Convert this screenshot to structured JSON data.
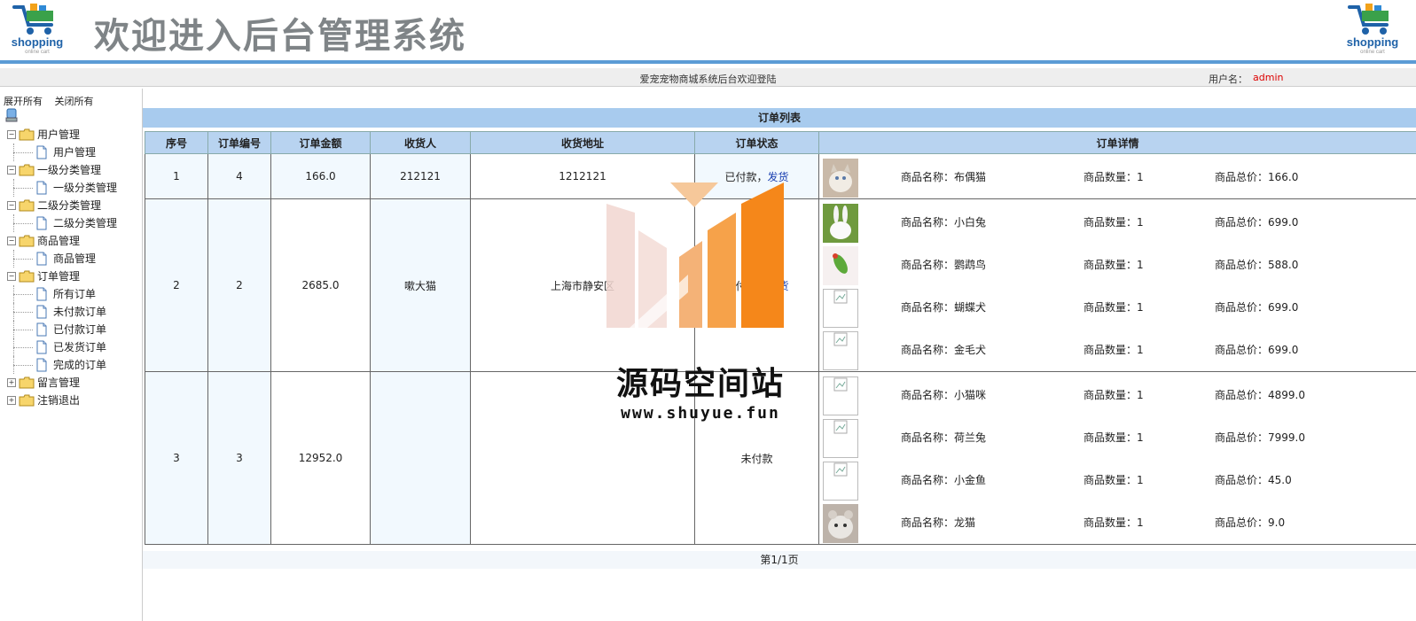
{
  "header": {
    "title": "欢迎进入后台管理系统",
    "logo_word": "shopping",
    "logo_sub": "online cart"
  },
  "welcome_bar": {
    "message": "爱宠宠物商城系统后台欢迎登陆",
    "user_label": "用户名：",
    "user_name": "admin"
  },
  "sidebar": {
    "expand_all": "展开所有",
    "collapse_all": "关闭所有",
    "groups": [
      {
        "label": "用户管理",
        "children": [
          "用户管理"
        ]
      },
      {
        "label": "一级分类管理",
        "children": [
          "一级分类管理"
        ]
      },
      {
        "label": "二级分类管理",
        "children": [
          "二级分类管理"
        ]
      },
      {
        "label": "商品管理",
        "children": [
          "商品管理"
        ]
      },
      {
        "label": "订单管理",
        "children": [
          "所有订单",
          "未付款订单",
          "已付款订单",
          "已发货订单",
          "完成的订单"
        ]
      },
      {
        "label": "留言管理",
        "children": []
      },
      {
        "label": "注销退出",
        "children": []
      }
    ]
  },
  "orders": {
    "caption": "订单列表",
    "headers": [
      "序号",
      "订单编号",
      "订单金额",
      "收货人",
      "收货地址",
      "订单状态",
      "订单详情"
    ],
    "detail_labels": {
      "name": "商品名称：",
      "qty": "商品数量：",
      "total": "商品总价："
    },
    "rows": [
      {
        "index": "1",
        "order_no": "4",
        "amount": "166.0",
        "receiver": "212121",
        "address": "1212121",
        "status": "已付款，",
        "action": "发货",
        "items": [
          {
            "name": "布偶猫",
            "qty": "1",
            "total": "166.0",
            "thumb": "photo-cat"
          }
        ]
      },
      {
        "index": "2",
        "order_no": "2",
        "amount": "2685.0",
        "receiver": "嗽大猫",
        "address": "上海市静安区",
        "status": "已付款，",
        "action": "发货",
        "items": [
          {
            "name": "小白兔",
            "qty": "1",
            "total": "699.0",
            "thumb": "photo-rabbit"
          },
          {
            "name": "鹦鹉鸟",
            "qty": "1",
            "total": "588.0",
            "thumb": "photo-parrot"
          },
          {
            "name": "蝴蝶犬",
            "qty": "1",
            "total": "699.0",
            "thumb": "broken"
          },
          {
            "name": "金毛犬",
            "qty": "1",
            "total": "699.0",
            "thumb": "broken"
          }
        ]
      },
      {
        "index": "3",
        "order_no": "3",
        "amount": "12952.0",
        "receiver": "",
        "address": "",
        "status": "未付款",
        "action": "",
        "items": [
          {
            "name": "小猫咪",
            "qty": "1",
            "total": "4899.0",
            "thumb": "broken"
          },
          {
            "name": "荷兰兔",
            "qty": "1",
            "total": "7999.0",
            "thumb": "broken"
          },
          {
            "name": "小金鱼",
            "qty": "1",
            "total": "45.0",
            "thumb": "broken"
          },
          {
            "name": "龙猫",
            "qty": "1",
            "total": "9.0",
            "thumb": "photo-chinchilla"
          }
        ]
      }
    ],
    "pager": "第1/1页"
  },
  "watermark": {
    "title": "源码空间站",
    "url": "www.shuyue.fun"
  }
}
